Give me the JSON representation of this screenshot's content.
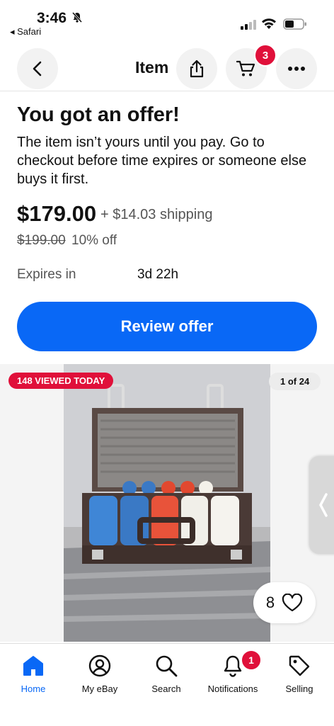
{
  "status_bar": {
    "time": "3:46",
    "back_app": "◂ Safari"
  },
  "nav": {
    "title": "Item",
    "cart_count": "3"
  },
  "offer": {
    "title": "You got an offer!",
    "body": "The item isn’t yours until you pay. Go to checkout before time expires or someone else buys it first.",
    "price": "$179.00",
    "shipping": "+ $14.03 shipping",
    "original_price": "$199.00",
    "discount": "10% off",
    "expires_label": "Expires in",
    "expires_value": "3d 22h",
    "review_button": "Review offer"
  },
  "gallery": {
    "viewed_badge": "148 VIEWED TODAY",
    "counter": "1 of 24",
    "watch_count": "8"
  },
  "tabs": [
    {
      "label": "Home",
      "icon": "home-icon",
      "active": true
    },
    {
      "label": "My eBay",
      "icon": "profile-icon"
    },
    {
      "label": "Search",
      "icon": "search-icon"
    },
    {
      "label": "Notifications",
      "icon": "bell-icon",
      "badge": "1"
    },
    {
      "label": "Selling",
      "icon": "tag-icon"
    }
  ],
  "colors": {
    "accent": "#0968f6",
    "badge": "#e0103a"
  }
}
